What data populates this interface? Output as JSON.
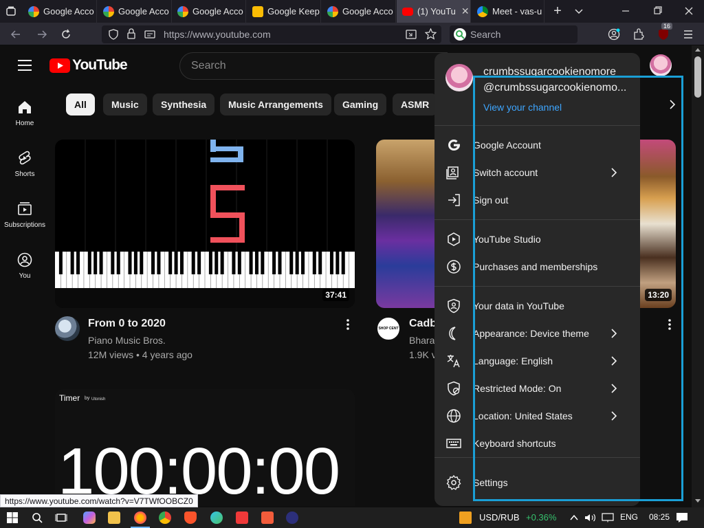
{
  "browser": {
    "tabs": [
      {
        "label": "Google Acco",
        "favicon": "google-icon",
        "active": false
      },
      {
        "label": "Google Acco",
        "favicon": "google-icon",
        "active": false
      },
      {
        "label": "Google Acco",
        "favicon": "google-icon",
        "active": false
      },
      {
        "label": "Google Keep",
        "favicon": "keep-icon",
        "active": false
      },
      {
        "label": "Google Acco",
        "favicon": "google-icon",
        "active": false
      },
      {
        "label": "(1) YouTu",
        "favicon": "youtube-icon",
        "active": true
      },
      {
        "label": "Meet - vas-u",
        "favicon": "meet-icon",
        "active": false
      }
    ],
    "url": "https://www.youtube.com",
    "search_placeholder": "Search",
    "extension_badge": "16"
  },
  "youtube": {
    "logo_text": "YouTube",
    "search_placeholder": "Search",
    "sidebar": [
      {
        "label": "Home",
        "icon": "home-icon"
      },
      {
        "label": "Shorts",
        "icon": "shorts-icon"
      },
      {
        "label": "Subscriptions",
        "icon": "subscriptions-icon"
      },
      {
        "label": "You",
        "icon": "you-icon"
      }
    ],
    "chips": [
      "All",
      "Music",
      "Synthesia",
      "Music Arrangements",
      "Gaming",
      "ASMR"
    ],
    "videos": [
      {
        "title": "From 0 to 2020",
        "channel": "Piano Music Bros.",
        "meta": "12M views • 4 years ago",
        "duration": "37:41",
        "thumb_number": "5"
      },
      {
        "title": "Cadb",
        "channel": "Bhara",
        "meta": "1.9K v",
        "channel_badge": "SHOP CENT"
      },
      {
        "duration": "13:20"
      }
    ],
    "timer": {
      "label": "Timer",
      "by": "by",
      "brand": "Utonish",
      "value": "100:00:00"
    }
  },
  "menu": {
    "account_name": "crumbssugarcookienomore",
    "handle": "@crumbssugarcookienomo...",
    "view_channel": "View your channel",
    "items": [
      {
        "label": "Google Account",
        "icon": "google-g-icon"
      },
      {
        "label": "Switch account",
        "icon": "switch-account-icon",
        "chevron": true
      },
      {
        "label": "Sign out",
        "icon": "sign-out-icon"
      },
      {
        "label": "YouTube Studio",
        "icon": "studio-icon"
      },
      {
        "label": "Purchases and memberships",
        "icon": "dollar-icon"
      },
      {
        "label": "Your data in YouTube",
        "icon": "shield-person-icon"
      },
      {
        "label": "Appearance: Device theme",
        "icon": "moon-icon",
        "chevron": true
      },
      {
        "label": "Language: English",
        "icon": "translate-icon",
        "chevron": true
      },
      {
        "label": "Restricted Mode: On",
        "icon": "restricted-icon",
        "chevron": true
      },
      {
        "label": "Location: United States",
        "icon": "globe-icon",
        "chevron": true
      },
      {
        "label": "Keyboard shortcuts",
        "icon": "keyboard-icon"
      },
      {
        "label": "Settings",
        "icon": "settings-icon"
      }
    ]
  },
  "statusbar": {
    "url": "https://www.youtube.com/watch?v=V7TWfOOBCZ0"
  },
  "taskbar": {
    "ticker": "USD/RUB",
    "change": "+0.36%",
    "lang": "ENG",
    "time": "08:25"
  },
  "colors": {
    "youtube_red": "#ff0000",
    "link_blue": "#3ea6ff",
    "highlight_box": "#1a9fd6",
    "ticker_green": "#36c26e"
  }
}
